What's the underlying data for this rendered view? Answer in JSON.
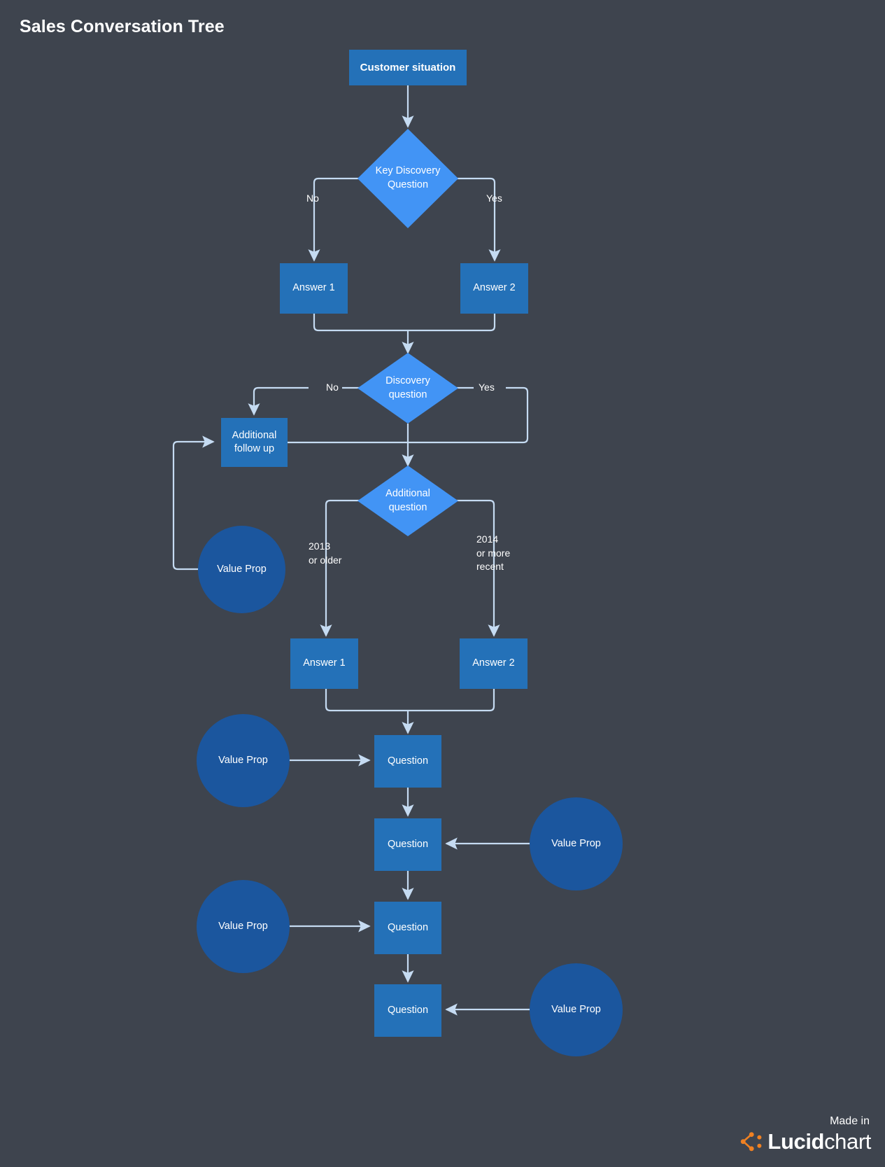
{
  "title": "Sales Conversation Tree",
  "colors": {
    "background": "#3e444e",
    "box_fill": "#2471b8",
    "diamond_fill": "#4294f5",
    "circle_fill": "#1b569e",
    "connector": "#c5dbf2",
    "text": "#ffffff",
    "logo_accent": "#f08122"
  },
  "nodes": {
    "customer_situation": {
      "label": "Customer situation",
      "shape": "rectangle"
    },
    "key_discovery_question": {
      "label": "Key Discovery\nQuestion",
      "shape": "diamond"
    },
    "answer_1_top": {
      "label": "Answer 1",
      "shape": "rectangle"
    },
    "answer_2_top": {
      "label": "Answer 2",
      "shape": "rectangle"
    },
    "discovery_question": {
      "label": "Discovery\nquestion",
      "shape": "diamond"
    },
    "additional_follow_up": {
      "label": "Additional\nfollow up",
      "shape": "rectangle"
    },
    "additional_question": {
      "label": "Additional\nquestion",
      "shape": "diamond"
    },
    "value_prop_followup": {
      "label": "Value Prop",
      "shape": "circle"
    },
    "answer_1_bottom": {
      "label": "Answer 1",
      "shape": "rectangle"
    },
    "answer_2_bottom": {
      "label": "Answer 2",
      "shape": "rectangle"
    },
    "question_1": {
      "label": "Question",
      "shape": "rectangle"
    },
    "question_2": {
      "label": "Question",
      "shape": "rectangle"
    },
    "question_3": {
      "label": "Question",
      "shape": "rectangle"
    },
    "question_4": {
      "label": "Question",
      "shape": "rectangle"
    },
    "value_prop_1": {
      "label": "Value Prop",
      "shape": "circle"
    },
    "value_prop_2": {
      "label": "Value Prop",
      "shape": "circle"
    },
    "value_prop_3": {
      "label": "Value Prop",
      "shape": "circle"
    },
    "value_prop_4": {
      "label": "Value Prop",
      "shape": "circle"
    }
  },
  "edge_labels": {
    "key_no": "No",
    "key_yes": "Yes",
    "discovery_no": "No",
    "discovery_yes": "Yes",
    "additional_left": "2013\nor older",
    "additional_right": "2014\nor more\nrecent"
  },
  "footer": {
    "made_in": "Made in",
    "brand_bold": "Lucid",
    "brand_light": "chart"
  }
}
